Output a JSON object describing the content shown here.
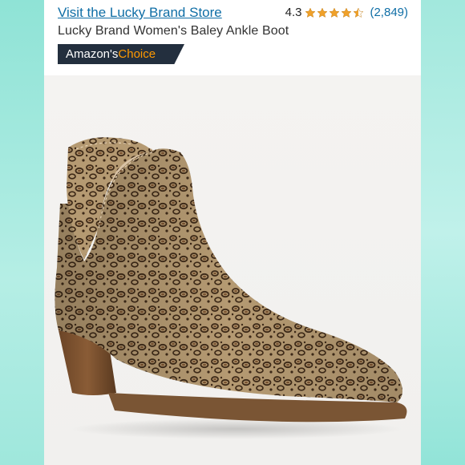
{
  "store": {
    "link_label": "Visit the Lucky Brand Store"
  },
  "rating": {
    "value": "4.3",
    "stars": 4.3,
    "count": "(2,849)"
  },
  "product": {
    "title": "Lucky Brand Women's Baley Ankle Boot"
  },
  "badge": {
    "prefix": "Amazon's",
    "accent": "Choice"
  },
  "colors": {
    "link": "#0f6ea6",
    "badge_bg": "#232f3e",
    "badge_accent": "#ff9900",
    "star": "#f0a12a",
    "frame": "#a8eadf"
  },
  "icons": {
    "rating_star": "star-icon",
    "product_image": "leopard-ankle-boot"
  }
}
